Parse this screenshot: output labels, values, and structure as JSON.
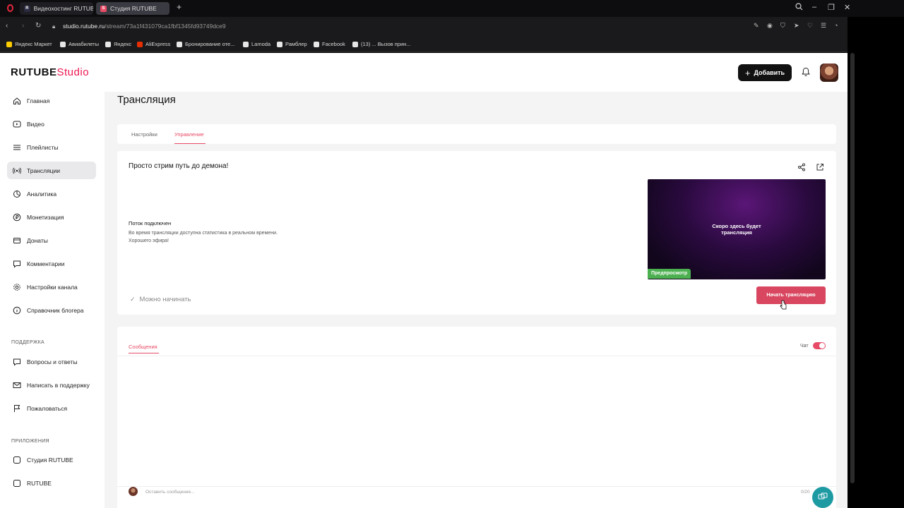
{
  "browser": {
    "tabs": [
      {
        "label": "Видеохостинг RUTUBE. С",
        "favicon": "R"
      },
      {
        "label": "Студия RUTUBE",
        "favicon": "S"
      }
    ],
    "url_host": "studio.rutube.ru",
    "url_path": "/stream/73a1f431079ca1fbf1345fd93749dce9",
    "bookmarks": [
      "Яндекс Маркет",
      "Авиабилеты",
      "Яндекс",
      "AliExpress",
      "Бронирование оте...",
      "Lamoda",
      "Рамблер",
      "Facebook",
      "(13) ... Вызов прин..."
    ]
  },
  "header": {
    "logo_main": "RUTUBE",
    "logo_studio": "Studio",
    "add_label": "Добавить"
  },
  "sidebar": {
    "items": [
      {
        "label": "Главная",
        "icon": "home-icon"
      },
      {
        "label": "Видео",
        "icon": "video-icon"
      },
      {
        "label": "Плейлисты",
        "icon": "playlist-icon"
      },
      {
        "label": "Трансляции",
        "icon": "broadcast-icon"
      },
      {
        "label": "Аналитика",
        "icon": "analytics-icon"
      },
      {
        "label": "Монетизация",
        "icon": "ruble-icon"
      },
      {
        "label": "Донаты",
        "icon": "donate-icon"
      },
      {
        "label": "Комментарии",
        "icon": "comment-icon"
      },
      {
        "label": "Настройки канала",
        "icon": "gear-icon"
      },
      {
        "label": "Справочник блогера",
        "icon": "info-icon"
      }
    ],
    "support_heading": "ПОДДЕРЖКА",
    "support_items": [
      {
        "label": "Вопросы и ответы",
        "icon": "faq-icon"
      },
      {
        "label": "Написать в поддержку",
        "icon": "mail-icon"
      },
      {
        "label": "Пожаловаться",
        "icon": "flag-icon"
      }
    ],
    "apps_heading": "ПРИЛОЖЕНИЯ",
    "apps_items": [
      {
        "label": "Студия RUTUBE",
        "icon": "studio-app-icon"
      },
      {
        "label": "RUTUBE",
        "icon": "rutube-app-icon"
      }
    ]
  },
  "main": {
    "title": "Трансляция",
    "tabs": [
      "Настройки",
      "Управление"
    ],
    "stream": {
      "title": "Просто стрим путь до демона!",
      "status_title": "Поток подключен",
      "status_line1": "Во время трансляции доступна статистика в реальном времени.",
      "status_line2": "Хорошего эфира!",
      "preview_line1": "Скоро здесь будет",
      "preview_line2": "трансляция",
      "preview_badge": "Предпросмотр",
      "ready_label": "Можно начинать",
      "start_label": "Начать трансляцию"
    },
    "chat": {
      "tab_label": "Сообщения",
      "toggle_label": "Чат",
      "input_placeholder": "Оставить сообщение...",
      "counter": "0/20"
    }
  },
  "colors": {
    "accent": "#e84b66",
    "start_button": "#d9465f",
    "preview_badge": "#4caf50",
    "help_button": "#1e9aa3"
  }
}
